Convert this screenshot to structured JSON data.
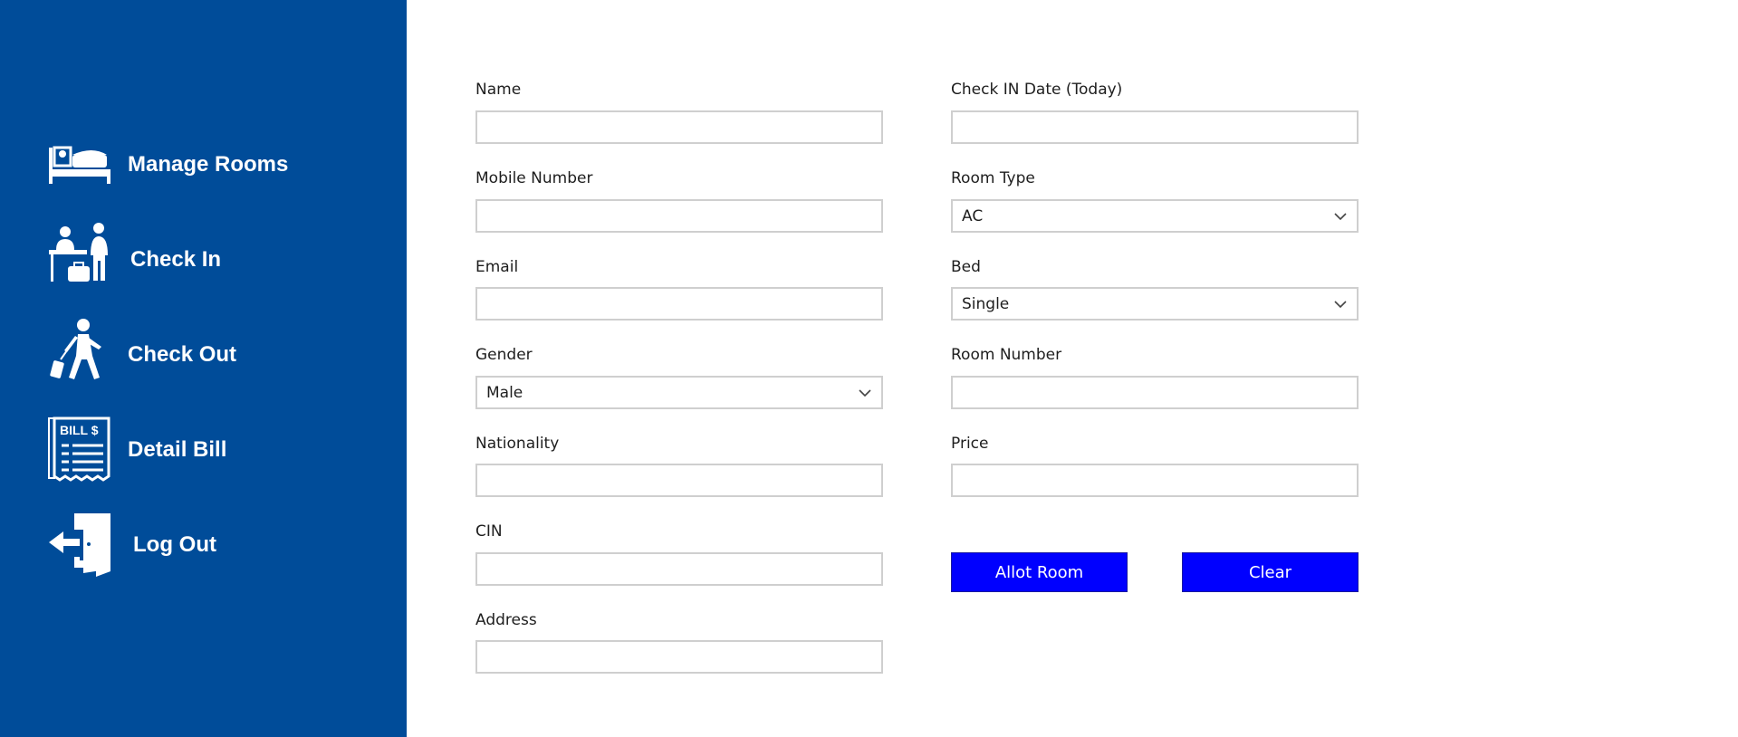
{
  "sidebar": {
    "background": "#004C99",
    "items": [
      {
        "label": "Manage Rooms",
        "icon": "bed-icon"
      },
      {
        "label": "Check In",
        "icon": "reception-icon"
      },
      {
        "label": "Check Out",
        "icon": "traveler-luggage-icon"
      },
      {
        "label": "Detail Bill",
        "icon": "bill-receipt-icon"
      },
      {
        "label": "Log Out",
        "icon": "door-exit-icon"
      }
    ],
    "bill_icon_text": "BILL $"
  },
  "form": {
    "name": {
      "label": "Name",
      "value": ""
    },
    "mobile": {
      "label": "Mobile Number",
      "value": ""
    },
    "email": {
      "label": "Email",
      "value": ""
    },
    "gender": {
      "label": "Gender",
      "value": "Male"
    },
    "nationality": {
      "label": "Nationality",
      "value": ""
    },
    "cin": {
      "label": "CIN",
      "value": ""
    },
    "address": {
      "label": "Address",
      "value": ""
    },
    "checkin_date": {
      "label": "Check IN Date (Today)",
      "value": ""
    },
    "room_type": {
      "label": "Room Type",
      "value": "AC"
    },
    "bed": {
      "label": "Bed",
      "value": "Single"
    },
    "room_number": {
      "label": "Room Number",
      "value": ""
    },
    "price": {
      "label": "Price",
      "value": ""
    }
  },
  "buttons": {
    "allot": "Allot Room",
    "clear": "Clear",
    "color": "#0000FF"
  }
}
